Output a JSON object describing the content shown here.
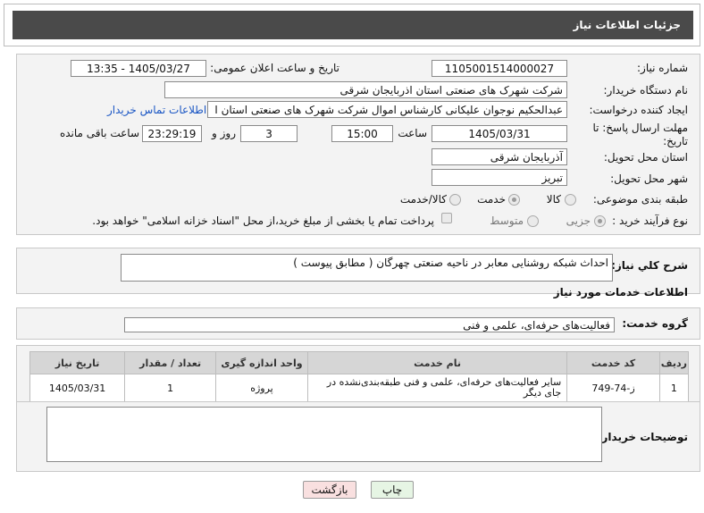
{
  "page": {
    "title": "جزئیات اطلاعات نیاز"
  },
  "info": {
    "need_number_label": "شماره نیاز:",
    "need_number": "1105001514000027",
    "announce_label": "تاریخ و ساعت اعلان عمومی:",
    "announce_value": "1405/03/27 - 13:35",
    "buyer_org_label": "نام دستگاه خریدار:",
    "buyer_org": "شرکت شهرک های صنعتی استان اذربایجان شرقی",
    "creator_label": "ایجاد کننده درخواست:",
    "creator": "عبدالحکیم نوجوان علیکانی کارشناس اموال شرکت شهرک های صنعتی استان ا",
    "contact_link": "اطلاعات تماس خریدار",
    "deadline_label_1": "مهلت ارسال پاسخ: تا",
    "deadline_label_2": "تاریخ:",
    "deadline_date": "1405/03/31",
    "time_label": "ساعت",
    "deadline_time": "15:00",
    "days_value": "3",
    "days_label": "روز و",
    "remaining_time": "23:29:19",
    "remaining_label": "ساعت باقی مانده",
    "province_label": "استان محل تحویل:",
    "province": "آذربایجان شرقی",
    "city_label": "شهر محل تحویل:",
    "city": "تبریز",
    "category_label": "طبقه بندی موضوعی:",
    "category_options": [
      "کالا",
      "خدمت",
      "کالا/خدمت"
    ],
    "category_selected": "خدمت",
    "process_label": "نوع فرآیند خرید :",
    "process_options": [
      "جزیی",
      "متوسط"
    ],
    "process_selected": "جزیی",
    "payment_note": "پرداخت تمام یا بخشی از مبلغ خرید،از محل \"اسناد خزانه اسلامی\" خواهد بود."
  },
  "summary": {
    "label": "شرح کلي نیاز:",
    "text": "احداث شبکه روشنایی معابر در ناحیه صنعتی چهرگان ( مطابق پیوست )"
  },
  "services": {
    "section_title": "اطلاعات خدمات مورد نیاز",
    "group_label": "گروه خدمت:",
    "group_value": "فعالیت‌های حرفه‌ای، علمی و فنی",
    "columns": [
      "ردیف",
      "کد خدمت",
      "نام خدمت",
      "واحد اندازه گیری",
      "تعداد / مقدار",
      "تاریخ نیاز"
    ],
    "rows": [
      {
        "row": "1",
        "code": "ز-74-749",
        "name": "سایر فعالیت‌های حرفه‌ای، علمی و فنی طبقه‌بندی‌نشده در جای دیگر",
        "unit": "پروژه",
        "qty": "1",
        "date": "1405/03/31"
      }
    ]
  },
  "buyer_notes": {
    "label": "توضیحات خریدار:",
    "text": ""
  },
  "buttons": {
    "print": "چاپ",
    "back": "بازگشت"
  },
  "colors": {
    "header_bg": "#4a4a4a",
    "link": "#1a56c4",
    "print_bg": "#e6f5e4",
    "back_bg": "#f9e0e0"
  }
}
